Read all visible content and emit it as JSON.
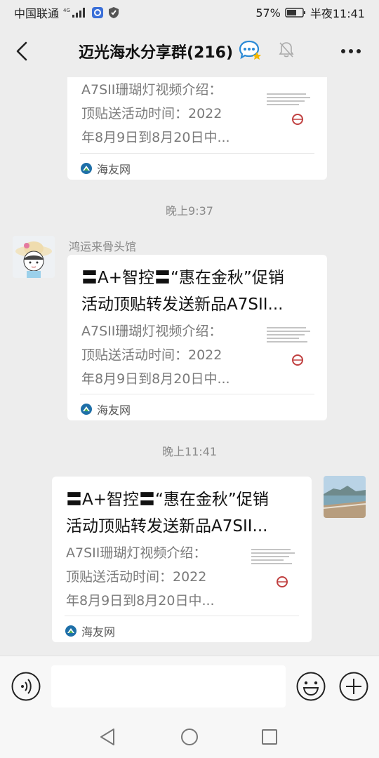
{
  "status_bar": {
    "carrier": "中国联通",
    "network": "4G",
    "battery": "57%",
    "time": "半夜11:41"
  },
  "header": {
    "title": "迈光海水分享群(216)"
  },
  "messages": [
    {
      "desc_lines": [
        "A7SII珊瑚灯视频介绍：",
        "顶贴送活动时间：2022",
        "年8月9日到8月20日中..."
      ],
      "source": "海友网"
    },
    {
      "timestamp": "晚上9:37"
    },
    {
      "sender": "鸿运来骨头馆",
      "title_lines": [
        "〓A+智控〓“惠在金秋”促销",
        "活动顶贴转发送新品A7SII..."
      ],
      "desc_lines": [
        "A7SII珊瑚灯视频介绍：",
        "顶贴送活动时间：2022",
        "年8月9日到8月20日中..."
      ],
      "source": "海友网"
    },
    {
      "timestamp": "晚上11:41"
    },
    {
      "title_lines": [
        "〓A+智控〓“惠在金秋”促销",
        "活动顶贴转发送新品A7SII..."
      ],
      "desc_lines": [
        "A7SII珊瑚灯视频介绍：",
        "顶贴送活动时间：2022",
        "年8月9日到8月20日中..."
      ],
      "source": "海友网"
    }
  ],
  "input": {
    "placeholder": ""
  },
  "icons": {
    "back": "back-arrow-icon",
    "chat_bubble": "group-chat-icon",
    "mute": "bell-muted-icon",
    "more": "more-dots-icon",
    "voice": "voice-icon",
    "emoji": "emoji-icon",
    "plus": "plus-icon"
  },
  "colors": {
    "background": "#ededed",
    "card": "#ffffff",
    "timestamp": "#8a8a8a",
    "source_badge": "#1e6fa8"
  }
}
